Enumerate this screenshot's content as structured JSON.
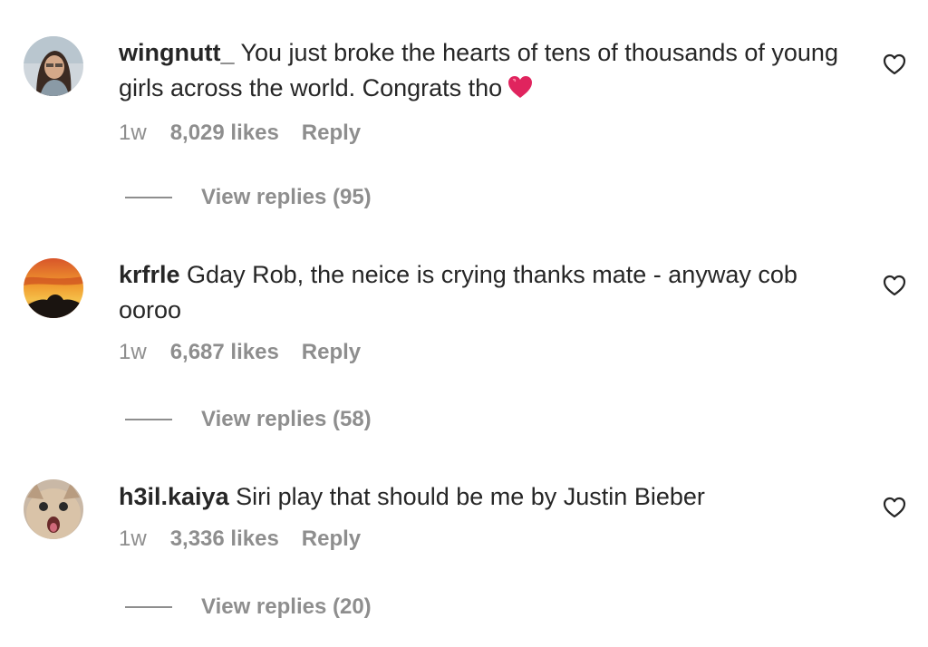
{
  "comments": [
    {
      "username": "wingnutt_",
      "text": " You just broke the hearts of tens of thousands of young girls across the world. Congrats tho",
      "emoji": "heart",
      "time": "1w",
      "likes": "8,029 likes",
      "reply_label": "Reply",
      "view_replies": "View replies (95)"
    },
    {
      "username": "krfrle",
      "text": " Gday Rob, the neice is crying thanks mate - anyway cob ooroo",
      "time": "1w",
      "likes": "6,687 likes",
      "reply_label": "Reply",
      "view_replies": "View replies (58)"
    },
    {
      "username": "h3il.kaiya",
      "text": " Siri play that should be me by Justin Bieber",
      "time": "1w",
      "likes": "3,336 likes",
      "reply_label": "Reply",
      "view_replies": "View replies (20)"
    }
  ],
  "colors": {
    "text": "#262626",
    "secondary": "#8e8e8e",
    "emoji_heart": "#e0245e"
  },
  "icons": {
    "like": "heart-outline-icon",
    "emoji": "red-heart-emoji-icon"
  }
}
